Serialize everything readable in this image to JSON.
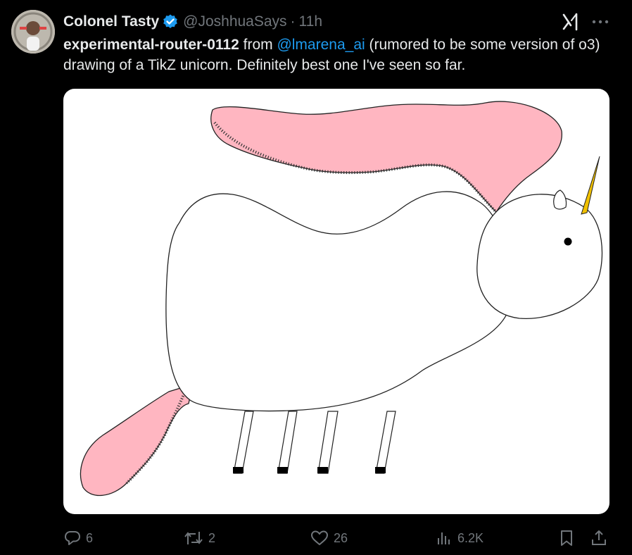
{
  "author": {
    "display_name": "Colonel Tasty",
    "handle": "@JoshhuaSays",
    "separator": "·",
    "time": "11h",
    "verified": true
  },
  "tweet": {
    "lead_bold": "experimental-router-0112",
    "text_1": " from ",
    "mention": "@lmarena_ai",
    "text_2": "  (rumored to be some version of o3) drawing of a TikZ unicorn. Definitely best one I've seen so far."
  },
  "media": {
    "description_icon": "unicorn-drawing",
    "colors": {
      "pink": "#ffb6c1",
      "horn": "#f0c000",
      "outline": "#222222"
    }
  },
  "actions": {
    "replies": "6",
    "reposts": "2",
    "likes": "26",
    "views": "6.2K"
  },
  "colors": {
    "background": "#000000",
    "text": "#e7e9ea",
    "muted": "#71767b",
    "link": "#1d9bf0",
    "verified": "#1d9bf0"
  }
}
